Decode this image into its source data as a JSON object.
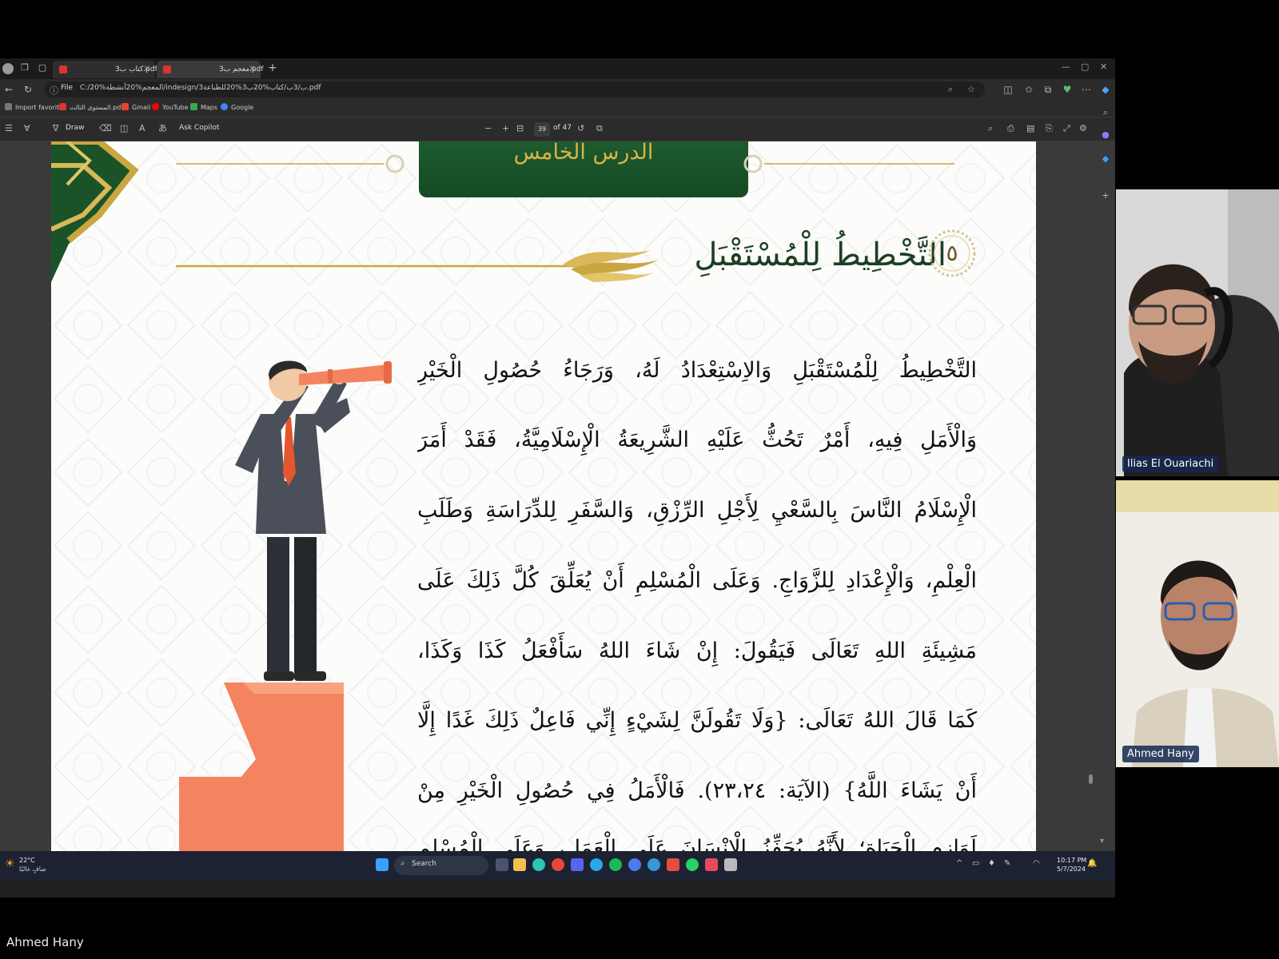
{
  "browser": {
    "tabs": [
      {
        "title": "كتاب ب3.pdf"
      },
      {
        "title": "معجم ب3.pdf"
      }
    ],
    "address": {
      "protocol": "File",
      "url": "C:/20%المعجم%20أنشطة/indesign/3ب/3ب/كتاب%20ب3%20للطباعة.pdf"
    },
    "favorites": [
      {
        "label": "Import favorites"
      },
      {
        "label": "المستوى الثالث.pdf"
      },
      {
        "label": "Gmail"
      },
      {
        "label": "YouTube"
      },
      {
        "label": "Maps"
      },
      {
        "label": "Google"
      }
    ],
    "pdf_toolbar": {
      "draw_label": "Draw",
      "copilot_label": "Ask Copilot",
      "current_page": "39",
      "page_total": "of 47"
    }
  },
  "document": {
    "lesson_label": "الدرس الخامس",
    "section_number": "٥",
    "section_title": "التَّخْطِيطُ لِلْمُسْتَقْبَلِ",
    "body_lines": [
      "التَّخْطِيطُ لِلْمُسْتَقْبَلِ وَالاِسْتِعْدَادُ لَهُ، وَرَجَاءُ حُصُولِ الْخَيْرِ",
      "وَالْأَمَلِ فِيهِ، أَمْرٌ تَحُثُّ عَلَيْهِ الشَّرِيعَةُ الْإِسْلَامِيَّةُ، فَقَدْ أَمَرَ",
      "الْإِسْلَامُ النَّاسَ بِالسَّعْيِ لِأَجْلِ الرِّزْقِ، وَالسَّفَرِ لِلدِّرَاسَةِ وَطَلَبِ",
      "الْعِلْمِ، وَالْإِعْدَادِ لِلزَّوَاجِ. وَعَلَى الْمُسْلِمِ أَنْ يُعَلِّقَ كُلَّ ذَلِكَ عَلَى",
      "مَشِيئَةِ اللهِ تَعَالَى فَيَقُولَ: إِنْ شَاءَ اللهُ سَأَفْعَلُ كَذَا وَكَذَا،",
      "كَمَا قَالَ اللهُ تَعَالَى: {وَلَا تَقُولَنَّ لِشَيْءٍ إِنِّي فَاعِلٌ ذَلِكَ غَدًا إِلَّا",
      "أَنْ يَشَاءَ اللَّهُ} (الآيَة: ٢٣،٢٤). فَالْأَمَلُ فِي حُصُولِ الْخَيْرِ مِنْ",
      "لَوَازِمِ الْحَيَاةِ؛ لِأَنَّهُ يُحَفِّزُ الْإِنْسَانَ عَلَى الْعَمَلِ، وَعَلَى الْمُسْلِمِ"
    ]
  },
  "taskbar": {
    "weather_temp": "22°C",
    "weather_desc": "صافٍ غالبًا",
    "search_label": "Search",
    "clock_time": "10:17 PM",
    "clock_date": "5/7/2024"
  },
  "meeting": {
    "presenter_name": "Ahmed Hany",
    "participants": [
      {
        "name": "Ilias El Ouariachi"
      },
      {
        "name": "Ahmed Hany"
      }
    ]
  },
  "colors": {
    "banner_green": "#1b5329",
    "gold": "#c9a640",
    "arrow_orange": "#f4845f",
    "suit_gray": "#4a4f59"
  }
}
